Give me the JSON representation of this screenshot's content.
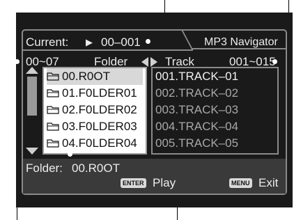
{
  "header": {
    "current_label": "Current:",
    "current_value": "00–001",
    "title": "MP3 Navigator"
  },
  "ranges": {
    "folder_range": "00~07",
    "folder_label": "Folder",
    "track_label": "Track",
    "track_range": "001~015"
  },
  "folders": [
    {
      "label": "00.R0OT",
      "selected": true
    },
    {
      "label": "01.F0LDER01"
    },
    {
      "label": "02.F0LDER02"
    },
    {
      "label": "03.F0LDER03"
    },
    {
      "label": "04.F0LDER04"
    }
  ],
  "tracks": [
    "001.TRACK–01",
    "002.TRACK–02",
    "003.TRACK–03",
    "004.TRACK–04",
    "005.TRACK–05"
  ],
  "status": {
    "folder_label": "Folder:",
    "folder_value": "00.R0OT"
  },
  "footer": {
    "enter_key": "ENTER",
    "enter_action": "Play",
    "menu_key": "MENU",
    "menu_action": "Exit"
  },
  "colors": {
    "screen_bg": "#1a1a1a",
    "frame": "#8a8a8a",
    "footer_band": "#3a3a3a"
  }
}
